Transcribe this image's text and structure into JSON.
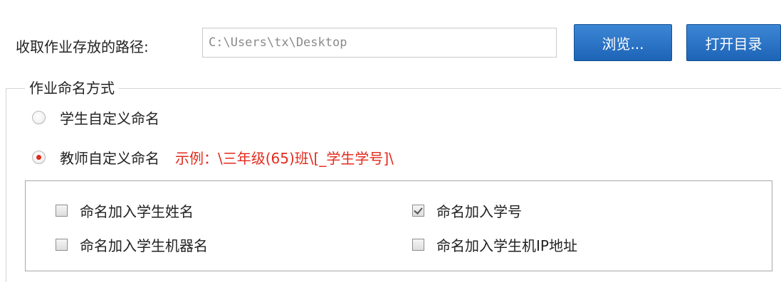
{
  "path_section": {
    "label": "收取作业存放的路径:",
    "path_value": "C:\\Users\\tx\\Desktop",
    "browse_label": "浏览...",
    "open_dir_label": "打开目录"
  },
  "naming": {
    "group_title": "作业命名方式",
    "options": [
      {
        "label": "学生自定义命名",
        "selected": false
      },
      {
        "label": "教师自定义命名",
        "selected": true
      }
    ],
    "example": "示例：\\三年级(65)班\\[_学生学号]\\"
  },
  "checkboxes": [
    {
      "label": "命名加入学生姓名",
      "checked": false
    },
    {
      "label": "命名加入学号",
      "checked": true
    },
    {
      "label": "命名加入学生机器名",
      "checked": false
    },
    {
      "label": "命名加入学生机IP地址",
      "checked": false
    }
  ],
  "colors": {
    "button_blue": "#2a73c5",
    "example_red": "#e32a1c",
    "radio_dot": "#e02b1c"
  },
  "icons": {
    "radio_unselected": "radio-empty-icon",
    "radio_selected": "radio-dot-icon",
    "checkbox_checked": "checkmark-icon"
  }
}
